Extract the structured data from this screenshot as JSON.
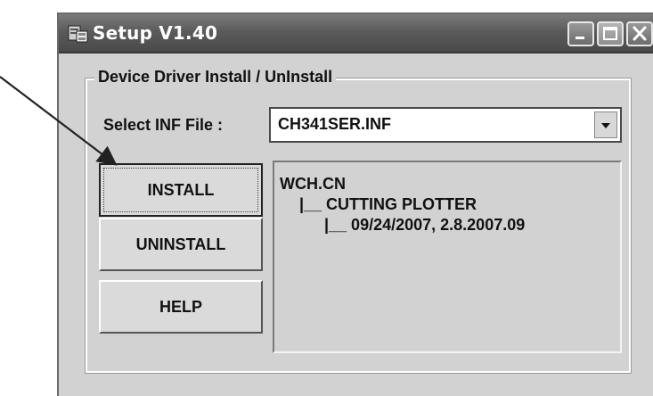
{
  "window": {
    "title": "Setup V1.40",
    "icons": {
      "app": "setup-app-icon",
      "minimize": "minimize-icon",
      "maximize": "maximize-icon",
      "close": "close-icon"
    }
  },
  "group": {
    "title": "Device Driver Install / UnInstall"
  },
  "inf": {
    "label": "Select INF File :",
    "selected": "CH341SER.INF",
    "dropdown_icon": "chevron-down-icon"
  },
  "buttons": {
    "install": "INSTALL",
    "uninstall": "UNINSTALL",
    "help": "HELP"
  },
  "driver_info": {
    "lines": [
      "WCH.CN",
      "|__ CUTTING PLOTTER",
      "|__ 09/24/2007, 2.8.2007.09"
    ]
  },
  "annotation": {
    "arrow_color": "#222222"
  },
  "colors": {
    "titlebar": "#5b5b5b",
    "window_bg": "#d2d2d2"
  }
}
